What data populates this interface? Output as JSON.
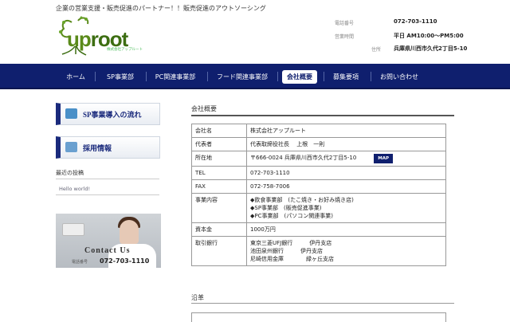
{
  "header": {
    "tagline": "企業の営業支援・販売促進のパートナー！！販売促進のアウトソーシング",
    "logo_text_u": "up",
    "logo_text_r": "root",
    "logo_sub": "株式会社アップルート",
    "phone_label": "電話番号",
    "phone_value": "072-703-1110",
    "hours_label": "営業時間",
    "hours_value": "平日 AM10:00〜PM5:00",
    "address_label": "住所",
    "address_value": "兵庫県川西市久代2丁目5-10"
  },
  "nav": {
    "items": [
      {
        "label": "ホーム"
      },
      {
        "label": "SP事業部"
      },
      {
        "label": "PC関連事業部"
      },
      {
        "label": "フード関連事業部"
      },
      {
        "label": "会社概要"
      },
      {
        "label": "募集要項"
      },
      {
        "label": "お問い合わせ"
      }
    ],
    "active_index": 4
  },
  "sidebar": {
    "banner1": "SP事業導入の流れ",
    "banner2": "採用情報",
    "recent_heading": "最近の投稿",
    "recent_link": "Hello world!",
    "contact_title": "Contact Us",
    "contact_tel_label": "電話番号",
    "contact_tel": "072-703-1110"
  },
  "main": {
    "section_title": "会社概要",
    "rows": [
      {
        "key": "会社名",
        "lines": [
          "株式会社アップルート"
        ]
      },
      {
        "key": "代表者",
        "lines": [
          "代表取締役社長　 上根　一則"
        ]
      },
      {
        "key": "所在地",
        "lines": [
          "〒666-0024 兵庫県川西市久代2丁目5-10"
        ],
        "badge": "MAP"
      },
      {
        "key": "TEL",
        "lines": [
          "072-703-1110"
        ]
      },
      {
        "key": "FAX",
        "lines": [
          "072-758-7006"
        ]
      },
      {
        "key": "事業内容",
        "lines": [
          "◆飲食事業部　(たこ焼き・お好み焼き店)",
          "◆SP事業部　(販売促進事業)",
          "◆PC事業部　(パソコン関連事業)"
        ]
      },
      {
        "key": "資本金",
        "lines": [
          "1000万円"
        ]
      },
      {
        "key": "取引銀行",
        "lines": [
          "東京三菱UFJ銀行　　　伊丹支店",
          "池田泉州銀行　　　伊丹支店",
          "尼崎信用金庫　　　　緑ヶ丘支店"
        ]
      }
    ],
    "history_title": "沿革"
  },
  "colors": {
    "nav_bg": "#0f1f6e",
    "logo_green": "#5a8a1a"
  }
}
